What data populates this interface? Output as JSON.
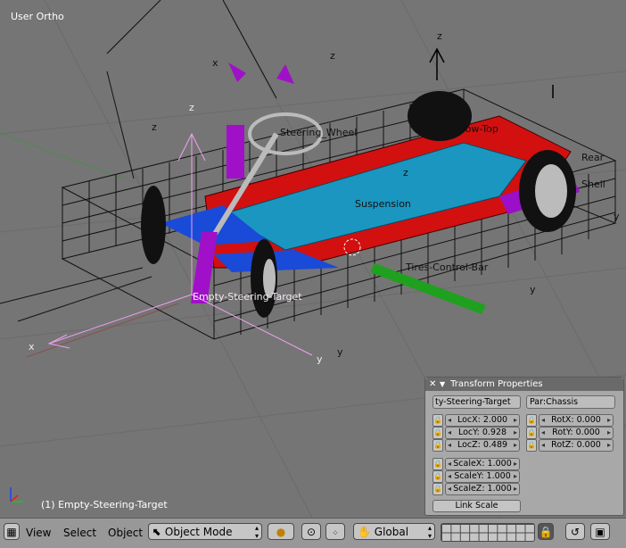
{
  "viewport": {
    "title": "User Ortho",
    "status": "(1) Empty-Steering-Target",
    "labels": {
      "steering_wheel": "Steering_Wheel",
      "window_top": "Window-Top",
      "suspension": "Suspension",
      "tires_control_bar": "Tires-Control-Bar",
      "empty_steering_target": "Empty-Steering-Target",
      "rear": "Rear",
      "shell": "Shell",
      "axis_x": "x",
      "axis_y": "y",
      "axis_z": "z"
    }
  },
  "panel": {
    "title": "Transform Properties",
    "object_name": "ty-Steering-Target",
    "parent": "Par:Chassis",
    "loc": [
      {
        "label": "LocX: 2.000"
      },
      {
        "label": "LocY: 0.928"
      },
      {
        "label": "LocZ: 0.489"
      }
    ],
    "rot": [
      {
        "label": "RotX: 0.000"
      },
      {
        "label": "RotY: 0.000"
      },
      {
        "label": "RotZ: 0.000"
      }
    ],
    "scale": [
      {
        "label": "ScaleX: 1.000"
      },
      {
        "label": "ScaleY: 1.000"
      },
      {
        "label": "ScaleZ: 1.000"
      }
    ],
    "link_scale": "Link Scale"
  },
  "toolbar": {
    "view": "View",
    "select": "Select",
    "object": "Object",
    "mode": "Object Mode",
    "orientation": "Global"
  },
  "icons": {
    "collapse": "close-icon",
    "mode": "object-mode-icon",
    "pivot": "pivot-icon",
    "snap": "magnet-icon",
    "hand": "hand-manipulator-icon",
    "lock": "lock-icon",
    "render": "render-icon"
  }
}
